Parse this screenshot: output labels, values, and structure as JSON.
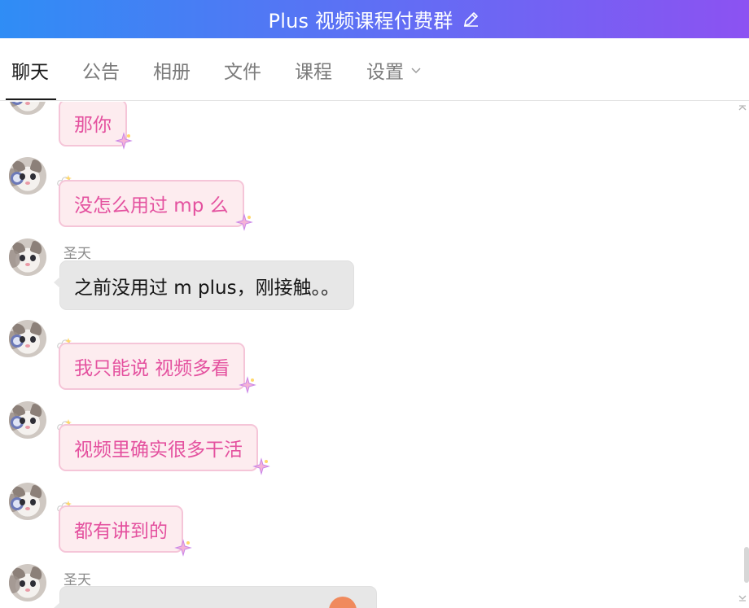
{
  "window": {
    "title": "Plus 视频课程付费群",
    "edit_icon": "pencil-icon"
  },
  "tabs": [
    {
      "label": "聊天",
      "active": true
    },
    {
      "label": "公告",
      "active": false
    },
    {
      "label": "相册",
      "active": false
    },
    {
      "label": "文件",
      "active": false
    },
    {
      "label": "课程",
      "active": false
    },
    {
      "label": "设置",
      "active": false,
      "has_dropdown": true
    }
  ],
  "messages": [
    {
      "sender": "",
      "text": "那你",
      "style": "pink"
    },
    {
      "sender": "",
      "text": "没怎么用过 mp 么",
      "style": "pink"
    },
    {
      "sender": "圣天",
      "text": "之前没用过 m plus，刚接触。。",
      "style": "gray"
    },
    {
      "sender": "",
      "text": "我只能说 视频多看",
      "style": "pink"
    },
    {
      "sender": "",
      "text": "视频里确实很多干活",
      "style": "pink"
    },
    {
      "sender": "",
      "text": "都有讲到的",
      "style": "pink"
    },
    {
      "sender": "圣天",
      "text": "",
      "style": "gray"
    }
  ],
  "colors": {
    "header_start": "#2f8df5",
    "header_end": "#8c52f2",
    "pink_text": "#e4519f",
    "pink_bubble": "#fdecef",
    "gray_bubble": "#e7e7e7"
  }
}
